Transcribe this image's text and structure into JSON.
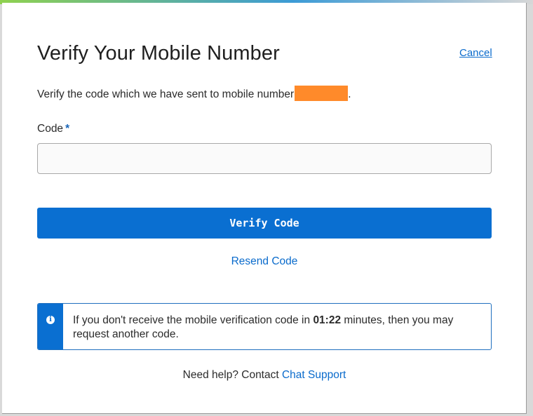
{
  "dialog": {
    "title": "Verify Your Mobile Number",
    "cancel_label": "Cancel",
    "description": "Verify the code which we have sent to mobile number",
    "description_end": "."
  },
  "form": {
    "code_label": "Code",
    "required_marker": "*",
    "code_value": "",
    "verify_button": "Verify Code",
    "resend_link": "Resend Code"
  },
  "info": {
    "icon": "info-icon",
    "text_before": "If you don't receive the mobile verification code in ",
    "countdown": "01:22",
    "text_after": " minutes, then you may request another code."
  },
  "help": {
    "prefix": "Need help? Contact ",
    "link": "Chat Support"
  },
  "colors": {
    "primary": "#0a6fd1",
    "link": "#0a6bcc",
    "redaction": "#ff8a2a"
  }
}
